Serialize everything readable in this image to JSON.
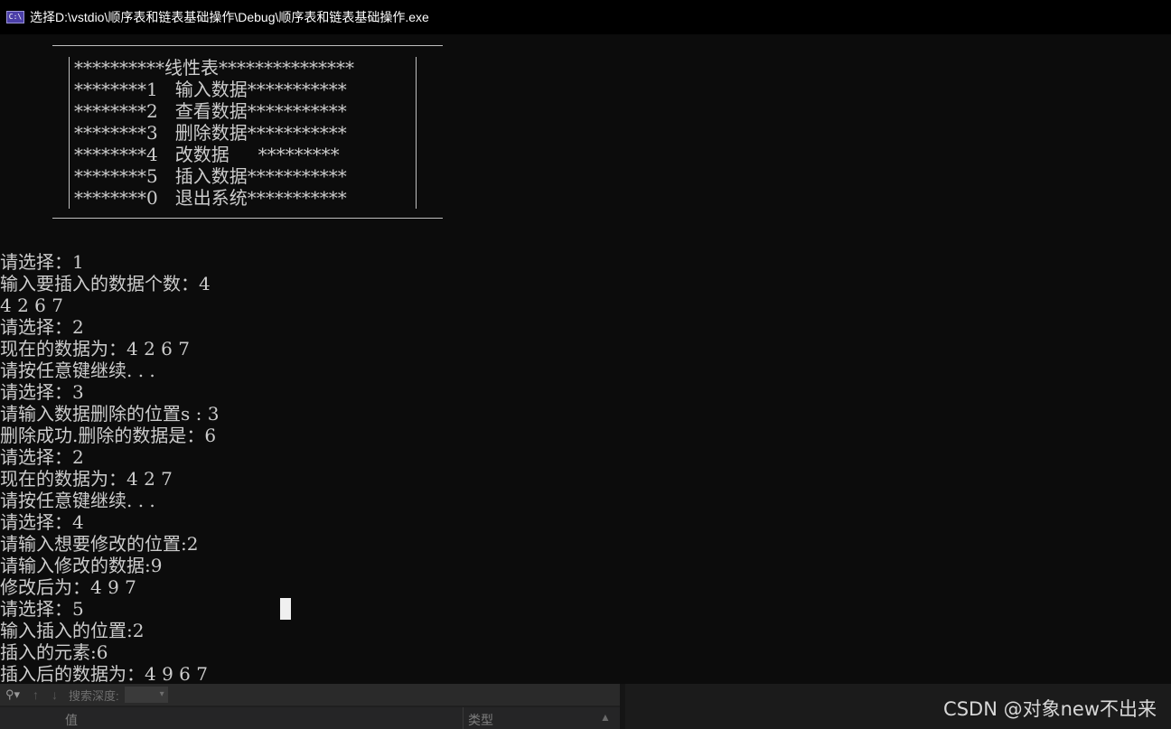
{
  "window": {
    "icon_label": "C:\\",
    "title": "选择D:\\vstdio\\顺序表和链表基础操作\\Debug\\顺序表和链表基础操作.exe"
  },
  "menu": {
    "lines": [
      "**********线性表***************",
      "********1   输入数据***********",
      "********2   查看数据***********",
      "********3   删除数据***********",
      "********4   改数据     *********",
      "********5   插入数据***********",
      "********0   退出系统***********"
    ]
  },
  "output": {
    "lines": [
      "请选择：1",
      "输入要插入的数据个数：4",
      "4 2 6 7",
      "请选择：2",
      "现在的数据为：4 2 6 7",
      "请按任意键继续. . .",
      "请选择：3",
      "请输入数据删除的位置s : 3",
      "删除成功.删除的数据是：6",
      "请选择：2",
      "现在的数据为：4 2 7",
      "请按任意键继续. . .",
      "请选择：4",
      "请输入想要修改的位置:2",
      "请输入修改的数据:9",
      "修改后为：4 9 7",
      "请选择：5",
      "输入插入的位置:2",
      "插入的元素:6",
      "插入后的数据为：4 9 6 7"
    ]
  },
  "debugger": {
    "search_icon": "search-icon",
    "search_label": "搜索深度:",
    "depth_dropdown": "▾",
    "col_value": "值",
    "col_type": "类型"
  },
  "watermark": "CSDN @对象new不出来"
}
